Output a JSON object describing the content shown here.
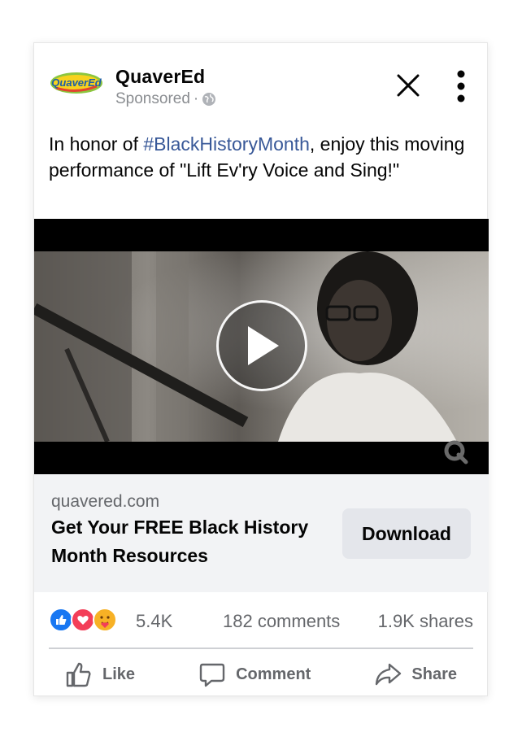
{
  "post": {
    "page_name": "QuaverEd",
    "sponsored_label": "Sponsored",
    "meta_separator": "·",
    "logo_text": "QuaverEd",
    "caption_before": "In honor of ",
    "hashtag": "#BlackHistoryMonth",
    "caption_after": ", enjoy this moving performance of \"Lift Ev'ry Voice and Sing!\""
  },
  "link": {
    "domain": "quavered.com",
    "headline": "Get Your FREE Black History Month Resources",
    "cta_label": "Download"
  },
  "engagement": {
    "reaction_count": "5.4K",
    "comments": "182 comments",
    "shares": "1.9K shares"
  },
  "actions": {
    "like": "Like",
    "comment": "Comment",
    "share": "Share"
  },
  "colors": {
    "hashtag": "#385898",
    "like_blue": "#1877f2",
    "love_red": "#f33e58",
    "care_yellow": "#f7b125"
  },
  "icons": {
    "close": "close-icon",
    "more": "more-vertical-icon",
    "globe": "globe-icon",
    "play": "play-icon",
    "like": "thumbs-up-icon",
    "comment": "comment-bubble-icon",
    "share": "share-arrow-icon"
  }
}
